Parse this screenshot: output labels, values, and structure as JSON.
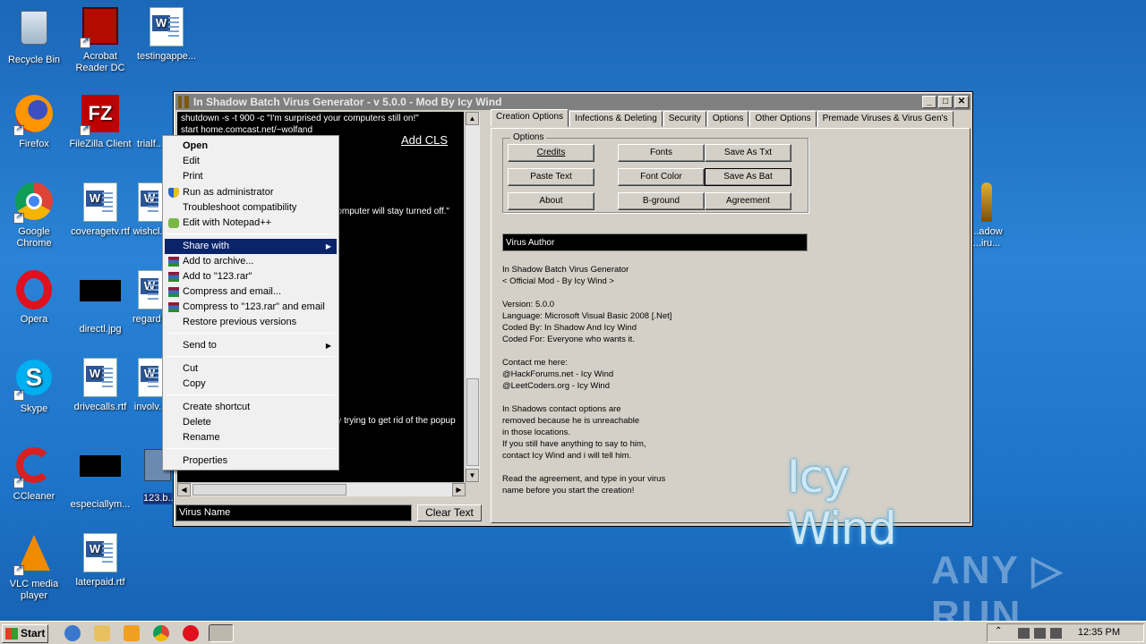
{
  "desktop": {
    "icons": [
      {
        "label": "Recycle Bin"
      },
      {
        "label": "Acrobat Reader DC"
      },
      {
        "label": "testingappe..."
      },
      {
        "label": "Firefox"
      },
      {
        "label": "FileZilla Client"
      },
      {
        "label": "trialf..."
      },
      {
        "label": "Google Chrome"
      },
      {
        "label": "coveragetv.rtf"
      },
      {
        "label": "wishcl..."
      },
      {
        "label": "Opera"
      },
      {
        "label": "directl.jpg"
      },
      {
        "label": "regard..."
      },
      {
        "label": "Skype"
      },
      {
        "label": "drivecalls.rtf"
      },
      {
        "label": "involv..."
      },
      {
        "label": "CCleaner"
      },
      {
        "label": "especiallym..."
      },
      {
        "label": "123.b..."
      },
      {
        "label": "VLC media player"
      },
      {
        "label": "laterpaid.rtf"
      },
      {
        "label": "...adow ...iru..."
      }
    ]
  },
  "window": {
    "title": "In Shadow Batch Virus Generator   -   v 5.0.0   -   Mod By Icy Wind",
    "minimize": "_",
    "maximize": "□",
    "close": "✕",
    "console_lines": [
      "shutdown -s -t 900 -c \"I'm surprised your computers still on!\"",
      "start home.comcast.net/~wolfand",
      "...omputer will stay turned off.\"",
      "...y trying to get rid of the popup"
    ],
    "add_cls": "Add CLS",
    "virus_name_placeholder": "Virus Name",
    "clear_text": "Clear Text",
    "tabs": [
      "Creation Options",
      "Infections & Deleting",
      "Security",
      "Options",
      "Other Options",
      "Premade Viruses & Virus Gen's"
    ],
    "options_group_label": "Options",
    "option_buttons": [
      "Credits",
      "Fonts",
      "Save As Txt",
      "Paste Text",
      "Font Color",
      "Save As Bat",
      "About",
      "B-ground",
      "Agreement"
    ],
    "virus_author_placeholder": "Virus Author",
    "about_text": "In Shadow Batch Virus Generator\n< Official Mod - By Icy Wind >\n\nVersion: 5.0.0\nLanguage: Microsoft Visual Basic 2008 [.Net]\nCoded By: In Shadow And Icy Wind\nCoded For: Everyone who wants it.\n\nContact me here:\n@HackForums.net - Icy Wind\n@LeetCoders.org - Icy Wind\n\nIn Shadows contact options are\nremoved because he is unreachable\nin those locations.\nIf you still have anything to say to him,\ncontact Icy Wind and i will tell him.\n\nRead the agreement, and type in your virus\nname before you start the creation!",
    "logo_text": "Icy Wind"
  },
  "context_menu": {
    "items": [
      {
        "label": "Open"
      },
      {
        "label": "Edit"
      },
      {
        "label": "Print"
      },
      {
        "label": "Run as administrator"
      },
      {
        "label": "Troubleshoot compatibility"
      },
      {
        "label": "Edit with Notepad++"
      },
      {
        "label": "Share with"
      },
      {
        "label": "Add to archive..."
      },
      {
        "label": "Add to \"123.rar\""
      },
      {
        "label": "Compress and email..."
      },
      {
        "label": "Compress to \"123.rar\" and email"
      },
      {
        "label": "Restore previous versions"
      },
      {
        "label": "Send to"
      },
      {
        "label": "Cut"
      },
      {
        "label": "Copy"
      },
      {
        "label": "Create shortcut"
      },
      {
        "label": "Delete"
      },
      {
        "label": "Rename"
      },
      {
        "label": "Properties"
      }
    ]
  },
  "taskbar": {
    "start": "Start",
    "clock": "12:35 PM"
  },
  "watermark": "ANY ▷ RUN"
}
